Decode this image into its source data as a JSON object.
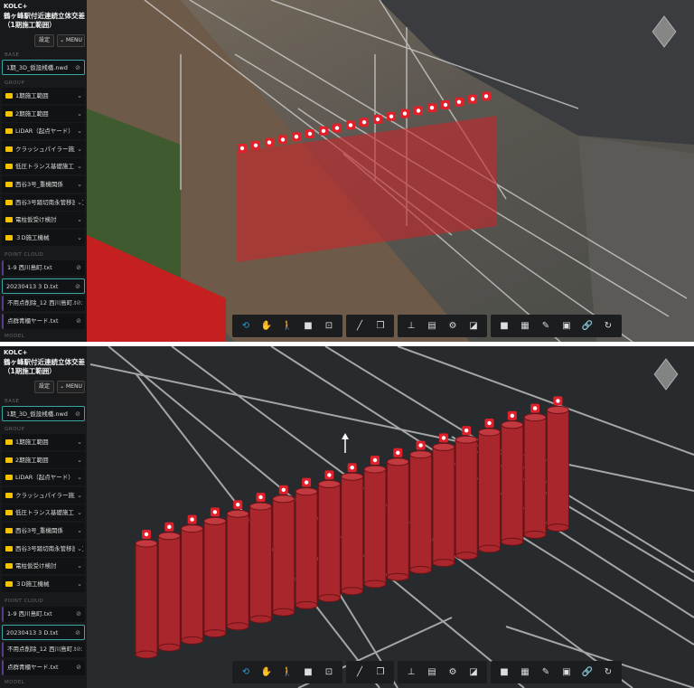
{
  "app": {
    "brand": "KOLC+",
    "project_title": "鶴ヶ峰駅付近連続立体交差（1期施工範囲）",
    "settings_label": "設定",
    "menu_label": "MENU"
  },
  "sidebar": {
    "base_label": "BASE",
    "base_file": "1期_3D_仮設桟橋.nwd",
    "group_label": "GROUP",
    "groups": [
      "1期施工範囲",
      "2期施工範囲",
      "LiDAR（起点ヤード）",
      "クラッシュパイラー施工",
      "低圧トランス基礎施工",
      "西谷3号_重機関係",
      "西谷3号踏切南永管移設工",
      "電柱仮受け検討",
      "３D施工機械"
    ],
    "point_cloud_label": "POINT CLOUD",
    "point_cloud_files": [
      {
        "name": "1-9 西川島町.txt",
        "selected": false
      },
      {
        "name": "20230413 3 D.txt",
        "selected": true
      },
      {
        "name": "不用点削除_12 西川島町.txt",
        "selected": false
      },
      {
        "name": "点群青櫃ヤード.txt",
        "selected": false
      }
    ],
    "model_label": "MODEL"
  },
  "toolbar": {
    "groups": [
      [
        {
          "icon": "orbit-icon",
          "glyph": "⟲",
          "active": true
        },
        {
          "icon": "pan-hand-icon",
          "glyph": "✋"
        },
        {
          "icon": "walk-icon",
          "glyph": "🚶"
        },
        {
          "icon": "camera-icon",
          "glyph": "■"
        },
        {
          "icon": "fit-view-icon",
          "glyph": "⊡"
        }
      ],
      [
        {
          "icon": "measure-icon",
          "glyph": "╱"
        },
        {
          "icon": "section-box-icon",
          "glyph": "❒"
        }
      ],
      [
        {
          "icon": "model-tree-icon",
          "glyph": "⊥"
        },
        {
          "icon": "properties-icon",
          "glyph": "▤"
        },
        {
          "icon": "settings-gear-icon",
          "glyph": "⚙"
        },
        {
          "icon": "fullscreen-icon",
          "glyph": "◪"
        }
      ],
      [
        {
          "icon": "video-icon",
          "glyph": "■"
        },
        {
          "icon": "grid-icon",
          "glyph": "▦"
        },
        {
          "icon": "pencil-icon",
          "glyph": "✎"
        },
        {
          "icon": "calendar-icon",
          "glyph": "▣"
        },
        {
          "icon": "link-icon",
          "glyph": "🔗",
          "active": true
        },
        {
          "icon": "refresh-icon",
          "glyph": "↻"
        }
      ]
    ]
  },
  "colors": {
    "accent": "#2f9bd8",
    "selection": "#3aa6a6",
    "marker": "#e0202a",
    "model_red": "#b0282e",
    "folder": "#f5c400"
  }
}
